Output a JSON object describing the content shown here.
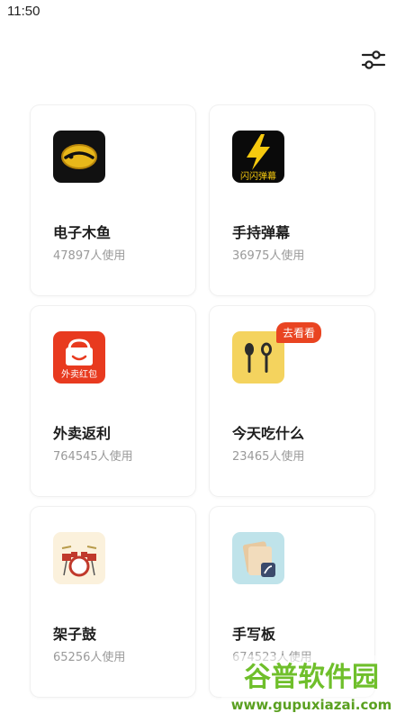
{
  "status_bar": {
    "time": "11:50"
  },
  "header": {
    "filter_icon": "sliders-icon"
  },
  "apps": [
    {
      "title": "电子木鱼",
      "usage": "47897人使用",
      "icon": "wooden-fish-icon"
    },
    {
      "title": "手持弹幕",
      "usage": "36975人使用",
      "icon": "lightning-icon",
      "icon_text": "闪闪弹幕"
    },
    {
      "title": "外卖返利",
      "usage": "764545人使用",
      "icon": "takeout-bag-icon",
      "icon_text": "外卖红包"
    },
    {
      "title": "今天吃什么",
      "usage": "23465人使用",
      "icon": "fork-spoon-icon",
      "badge": "去看看"
    },
    {
      "title": "架子鼓",
      "usage": "65256人使用",
      "icon": "drum-kit-icon"
    },
    {
      "title": "手写板",
      "usage": "674523人使用",
      "icon": "handwriting-pad-icon"
    }
  ],
  "watermark": {
    "text": "谷普软件园",
    "url": "www.gupuxiazai.com"
  },
  "colors": {
    "badge": "#e94421",
    "title": "#1d1d1d",
    "usage": "#9a9a9a"
  }
}
